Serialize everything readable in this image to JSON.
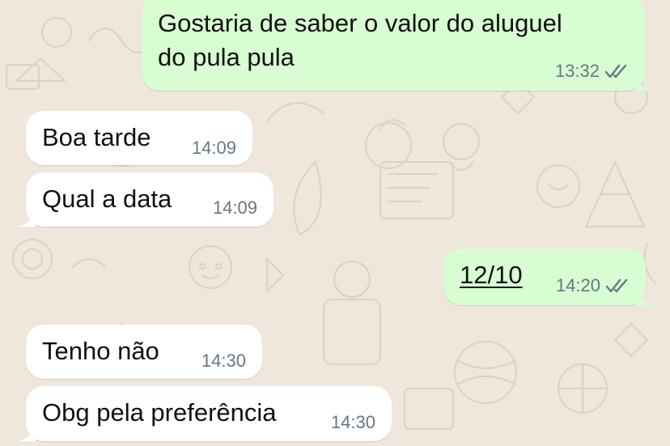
{
  "chat": {
    "messages": [
      {
        "direction": "out",
        "text_line1": "Gostaria de saber o valor do aluguel",
        "text_line2": "do pula pula",
        "time": "13:32",
        "status": "read"
      },
      {
        "direction": "in",
        "text": "Boa tarde",
        "time": "14:09"
      },
      {
        "direction": "in",
        "text": "Qual a data",
        "time": "14:09"
      },
      {
        "direction": "out",
        "text": "12/10",
        "time": "14:20",
        "status": "read"
      },
      {
        "direction": "in",
        "text": "Tenho não",
        "time": "14:30"
      },
      {
        "direction": "in",
        "text": "Obg pela preferência",
        "time": "14:30"
      }
    ]
  },
  "theme": {
    "background": "#efe7dc",
    "incoming_bubble": "#ffffff",
    "outgoing_bubble": "#d9fdd3",
    "meta_text": "#667781"
  },
  "icons": {
    "read_receipt": "double-check-icon"
  }
}
